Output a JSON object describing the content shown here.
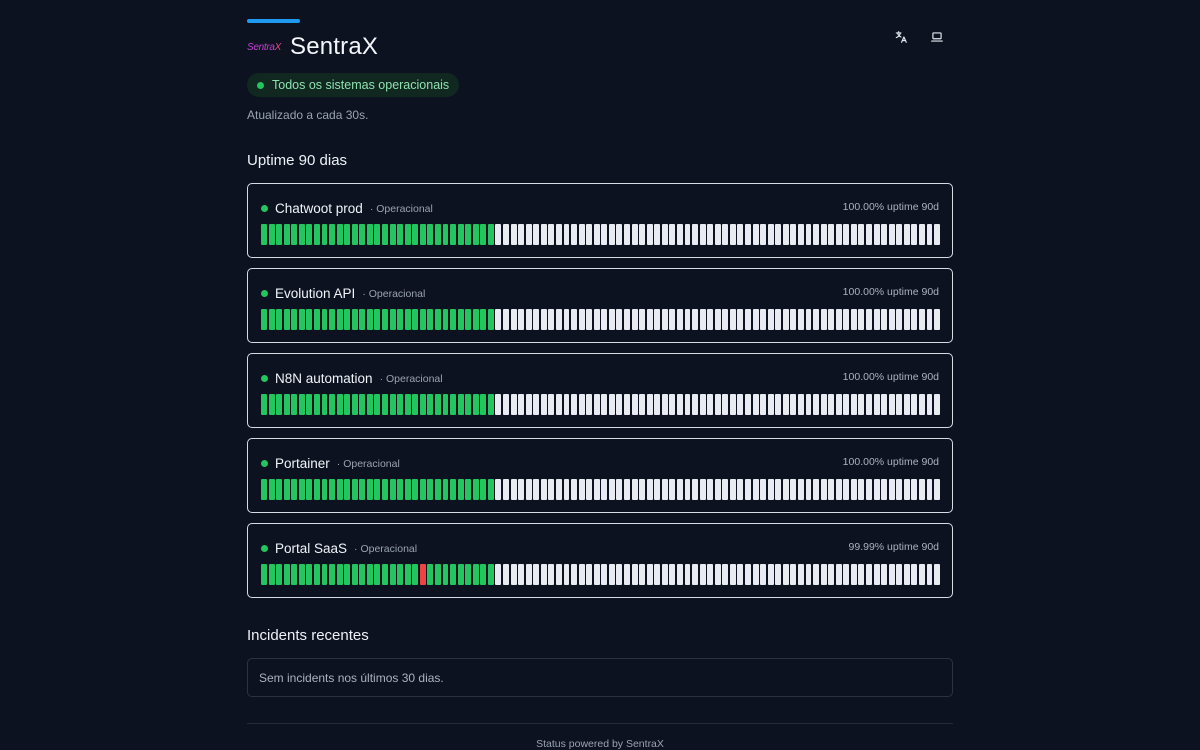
{
  "brand": {
    "logo_part1": "Sentra",
    "logo_part2": "X",
    "name": "SentraX",
    "accent_color": "#1e9bf0"
  },
  "header_icons": [
    "translate-icon",
    "laptop-icon"
  ],
  "status": {
    "text": "Todos os sistemas operacionais",
    "color": "#22c55e"
  },
  "updated_text": "Atualizado a cada 30s.",
  "uptime_section": {
    "title": "Uptime 90 dias"
  },
  "monitors": [
    {
      "name": "Chatwoot prod",
      "status": "· Operacional",
      "uptime": "100.00% uptime 90d",
      "up_days": 31,
      "down_days": [],
      "total_days": 90
    },
    {
      "name": "Evolution API",
      "status": "· Operacional",
      "uptime": "100.00% uptime 90d",
      "up_days": 31,
      "down_days": [],
      "total_days": 90
    },
    {
      "name": "N8N automation",
      "status": "· Operacional",
      "uptime": "100.00% uptime 90d",
      "up_days": 31,
      "down_days": [],
      "total_days": 90
    },
    {
      "name": "Portainer",
      "status": "· Operacional",
      "uptime": "100.00% uptime 90d",
      "up_days": 31,
      "down_days": [],
      "total_days": 90
    },
    {
      "name": "Portal SaaS",
      "status": "· Operacional",
      "uptime": "99.99% uptime 90d",
      "up_days": 31,
      "down_days": [
        21
      ],
      "total_days": 90
    }
  ],
  "incidents": {
    "title": "Incidents recentes",
    "empty_text": "Sem incidents nos últimos 30 dias."
  },
  "footer": "Status powered by SentraX"
}
